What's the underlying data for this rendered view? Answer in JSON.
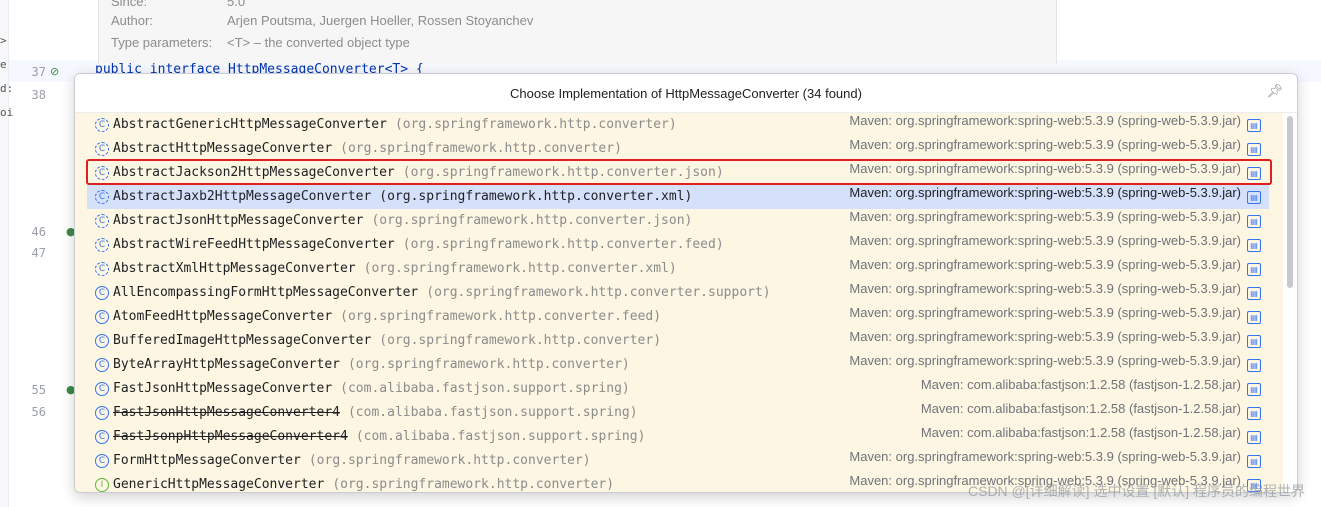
{
  "editor": {
    "javadoc": {
      "since_label": "Since:",
      "since_value": "5.0",
      "author_label": "Author:",
      "author_value": "Arjen Poutsma, Juergen Hoeller, Rossen Stoyanchev",
      "type_params_label": "Type parameters:",
      "type_params_value": "<T> – the converted object type"
    },
    "line_numbers": [
      "37",
      "38",
      "46",
      "47",
      "55",
      "56"
    ],
    "code_line_37": "public interface HttpMessageConverter<T> {",
    "left_strip_chars": [
      ">",
      "e",
      "d:",
      "oi"
    ]
  },
  "popup": {
    "title": "Choose Implementation of HttpMessageConverter (34 found)",
    "pin_icon": "pin-icon",
    "items": [
      {
        "name": "AbstractGenericHttpMessageConverter",
        "pkg": "(org.springframework.http.converter)",
        "src": "Maven: org.springframework:spring-web:5.3.9 (spring-web-5.3.9.jar)",
        "kind": "abstract"
      },
      {
        "name": "AbstractHttpMessageConverter",
        "pkg": "(org.springframework.http.converter)",
        "src": "Maven: org.springframework:spring-web:5.3.9 (spring-web-5.3.9.jar)",
        "kind": "abstract"
      },
      {
        "name": "AbstractJackson2HttpMessageConverter",
        "pkg": "(org.springframework.http.converter.json)",
        "src": "Maven: org.springframework:spring-web:5.3.9 (spring-web-5.3.9.jar)",
        "kind": "abstract"
      },
      {
        "name": "AbstractJaxb2HttpMessageConverter",
        "pkg": "(org.springframework.http.converter.xml)",
        "src": "Maven: org.springframework:spring-web:5.3.9 (spring-web-5.3.9.jar)",
        "kind": "abstract"
      },
      {
        "name": "AbstractJsonHttpMessageConverter",
        "pkg": "(org.springframework.http.converter.json)",
        "src": "Maven: org.springframework:spring-web:5.3.9 (spring-web-5.3.9.jar)",
        "kind": "abstract"
      },
      {
        "name": "AbstractWireFeedHttpMessageConverter",
        "pkg": "(org.springframework.http.converter.feed)",
        "src": "Maven: org.springframework:spring-web:5.3.9 (spring-web-5.3.9.jar)",
        "kind": "abstract"
      },
      {
        "name": "AbstractXmlHttpMessageConverter",
        "pkg": "(org.springframework.http.converter.xml)",
        "src": "Maven: org.springframework:spring-web:5.3.9 (spring-web-5.3.9.jar)",
        "kind": "abstract"
      },
      {
        "name": "AllEncompassingFormHttpMessageConverter",
        "pkg": "(org.springframework.http.converter.support)",
        "src": "Maven: org.springframework:spring-web:5.3.9 (spring-web-5.3.9.jar)",
        "kind": "class"
      },
      {
        "name": "AtomFeedHttpMessageConverter",
        "pkg": "(org.springframework.http.converter.feed)",
        "src": "Maven: org.springframework:spring-web:5.3.9 (spring-web-5.3.9.jar)",
        "kind": "class"
      },
      {
        "name": "BufferedImageHttpMessageConverter",
        "pkg": "(org.springframework.http.converter)",
        "src": "Maven: org.springframework:spring-web:5.3.9 (spring-web-5.3.9.jar)",
        "kind": "class"
      },
      {
        "name": "ByteArrayHttpMessageConverter",
        "pkg": "(org.springframework.http.converter)",
        "src": "Maven: org.springframework:spring-web:5.3.9 (spring-web-5.3.9.jar)",
        "kind": "class"
      },
      {
        "name": "FastJsonHttpMessageConverter",
        "pkg": "(com.alibaba.fastjson.support.spring)",
        "src": "Maven: com.alibaba:fastjson:1.2.58 (fastjson-1.2.58.jar)",
        "kind": "class"
      },
      {
        "name": "FastJsonHttpMessageConverter4",
        "pkg": "(com.alibaba.fastjson.support.spring)",
        "src": "Maven: com.alibaba:fastjson:1.2.58 (fastjson-1.2.58.jar)",
        "kind": "class",
        "deprecated": true
      },
      {
        "name": "FastJsonpHttpMessageConverter4",
        "pkg": "(com.alibaba.fastjson.support.spring)",
        "src": "Maven: com.alibaba:fastjson:1.2.58 (fastjson-1.2.58.jar)",
        "kind": "class",
        "deprecated": true
      },
      {
        "name": "FormHttpMessageConverter",
        "pkg": "(org.springframework.http.converter)",
        "src": "Maven: org.springframework:spring-web:5.3.9 (spring-web-5.3.9.jar)",
        "kind": "class"
      },
      {
        "name": "GenericHttpMessageConverter",
        "pkg": "(org.springframework.http.converter)",
        "src": "Maven: org.springframework:spring-web:5.3.9 (spring-web-5.3.9.jar)",
        "kind": "interface"
      }
    ],
    "selected_index": 3,
    "highlighted_index": 2,
    "colors": {
      "selection": "#d5e1fb",
      "highlight_box": "#e02020",
      "list_bg": "#fdf6e3"
    }
  },
  "watermark": "CSDN @[详细解读] 选中设置 [默认] 程序员的编程世界"
}
